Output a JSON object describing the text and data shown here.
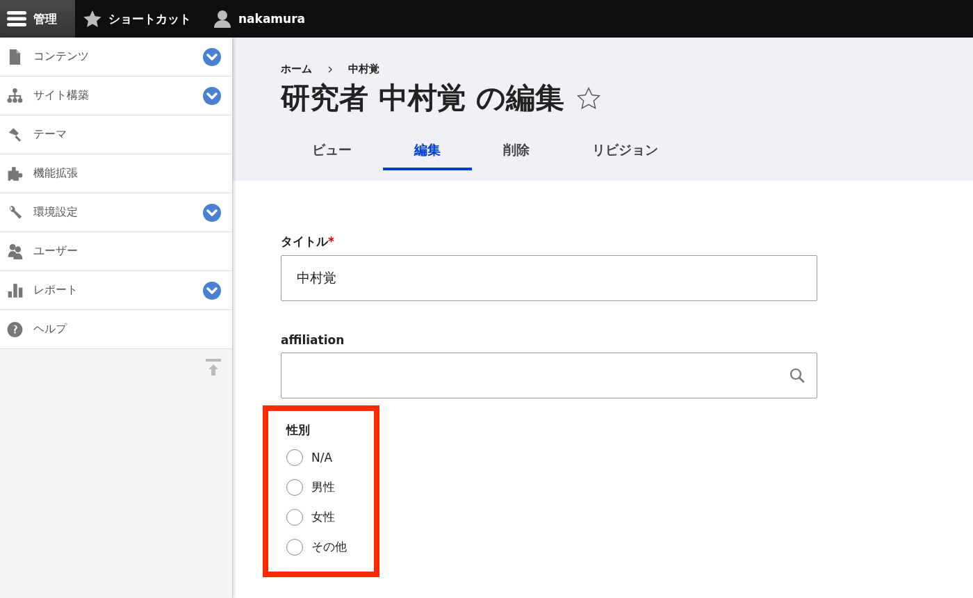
{
  "toolbar": {
    "menu": "管理",
    "shortcuts": "ショートカット",
    "user": "nakamura"
  },
  "sidebar": {
    "items": [
      {
        "label": "コンテンツ",
        "expandable": true
      },
      {
        "label": "サイト構築",
        "expandable": true
      },
      {
        "label": "テーマ",
        "expandable": false
      },
      {
        "label": "機能拡張",
        "expandable": false
      },
      {
        "label": "環境設定",
        "expandable": true
      },
      {
        "label": "ユーザー",
        "expandable": false
      },
      {
        "label": "レポート",
        "expandable": true
      },
      {
        "label": "ヘルプ",
        "expandable": false
      }
    ]
  },
  "breadcrumb": [
    "ホーム",
    "中村覚"
  ],
  "page_title": "研究者 中村覚 の編集",
  "tabs": [
    {
      "label": "ビュー",
      "selected": false
    },
    {
      "label": "編集",
      "selected": true
    },
    {
      "label": "削除",
      "selected": false
    },
    {
      "label": "リビジョン",
      "selected": false
    }
  ],
  "form": {
    "title": {
      "label": "タイトル",
      "required_mark": "*",
      "value": "中村覚"
    },
    "affiliation": {
      "label": "affiliation"
    },
    "gender": {
      "label": "性別",
      "highlighted": true,
      "options": [
        {
          "label": "N/A",
          "selected": false
        },
        {
          "label": "男性",
          "selected": false
        },
        {
          "label": "女性",
          "selected": false
        },
        {
          "label": "その他",
          "selected": false
        }
      ]
    }
  }
}
